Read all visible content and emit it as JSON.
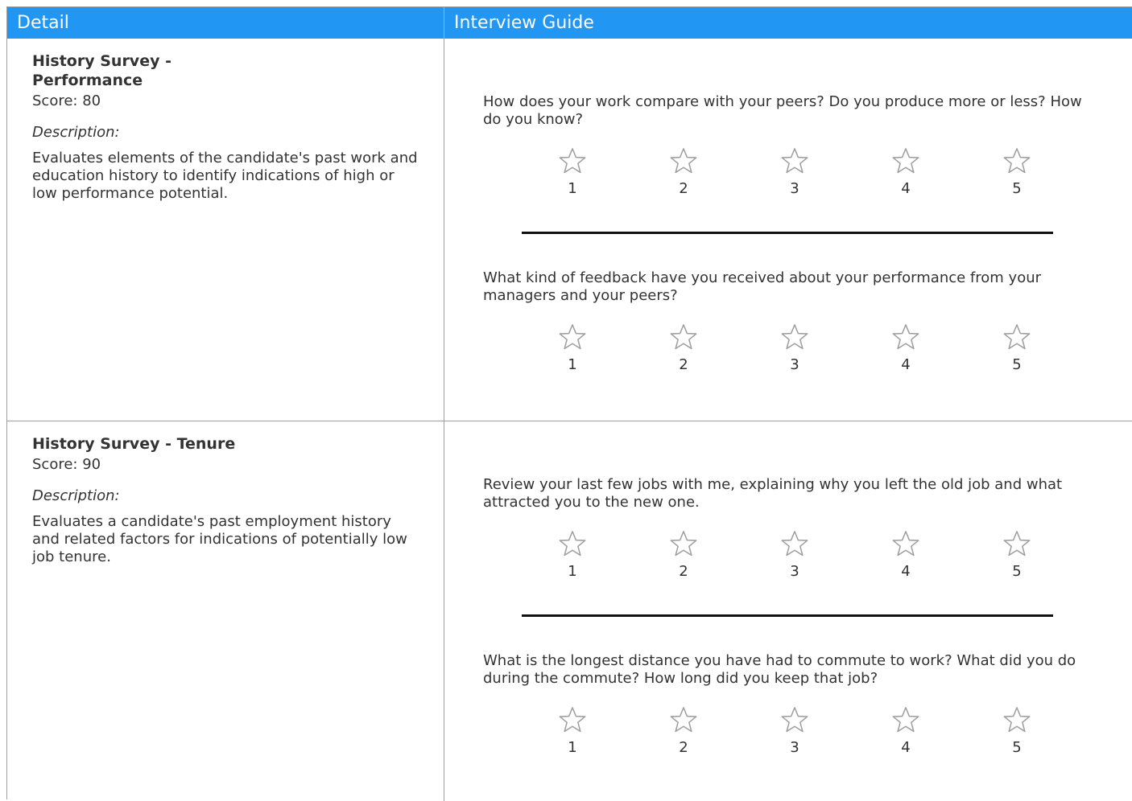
{
  "columns": {
    "detail": "Detail",
    "guide": "Interview Guide"
  },
  "sections": [
    {
      "title": "History Survey - Performance",
      "score": "Score: 80",
      "description_label": "Description:",
      "description": "Evaluates elements of the candidate's past work and education history to identify indications of high or low performance potential.",
      "questions": [
        {
          "text": "How does your work compare with your peers? Do you produce more or less? How do you know?",
          "rating": 0,
          "scale": [
            "1",
            "2",
            "3",
            "4",
            "5"
          ]
        },
        {
          "text": "What kind of feedback have you received about your performance from your managers and your peers?",
          "rating": 0,
          "scale": [
            "1",
            "2",
            "3",
            "4",
            "5"
          ]
        }
      ]
    },
    {
      "title": "History Survey - Tenure",
      "score": "Score: 90",
      "description_label": "Description:",
      "description": "Evaluates a candidate's past employment history and related factors for indications of potentially low job tenure.",
      "questions": [
        {
          "text": "Review your last few jobs with me, explaining why you left the old job and what attracted you to the new one.",
          "rating": 0,
          "scale": [
            "1",
            "2",
            "3",
            "4",
            "5"
          ]
        },
        {
          "text": "What is the longest distance you have had to commute to work? What did you do during the commute? How long did you keep that job?",
          "rating": 0,
          "scale": [
            "1",
            "2",
            "3",
            "4",
            "5"
          ]
        }
      ]
    }
  ],
  "colors": {
    "header": "#2196f3",
    "star_fill": "#ffffff",
    "star_stroke": "#9e9e9e"
  },
  "icons": {
    "star": "star-outline-icon"
  }
}
